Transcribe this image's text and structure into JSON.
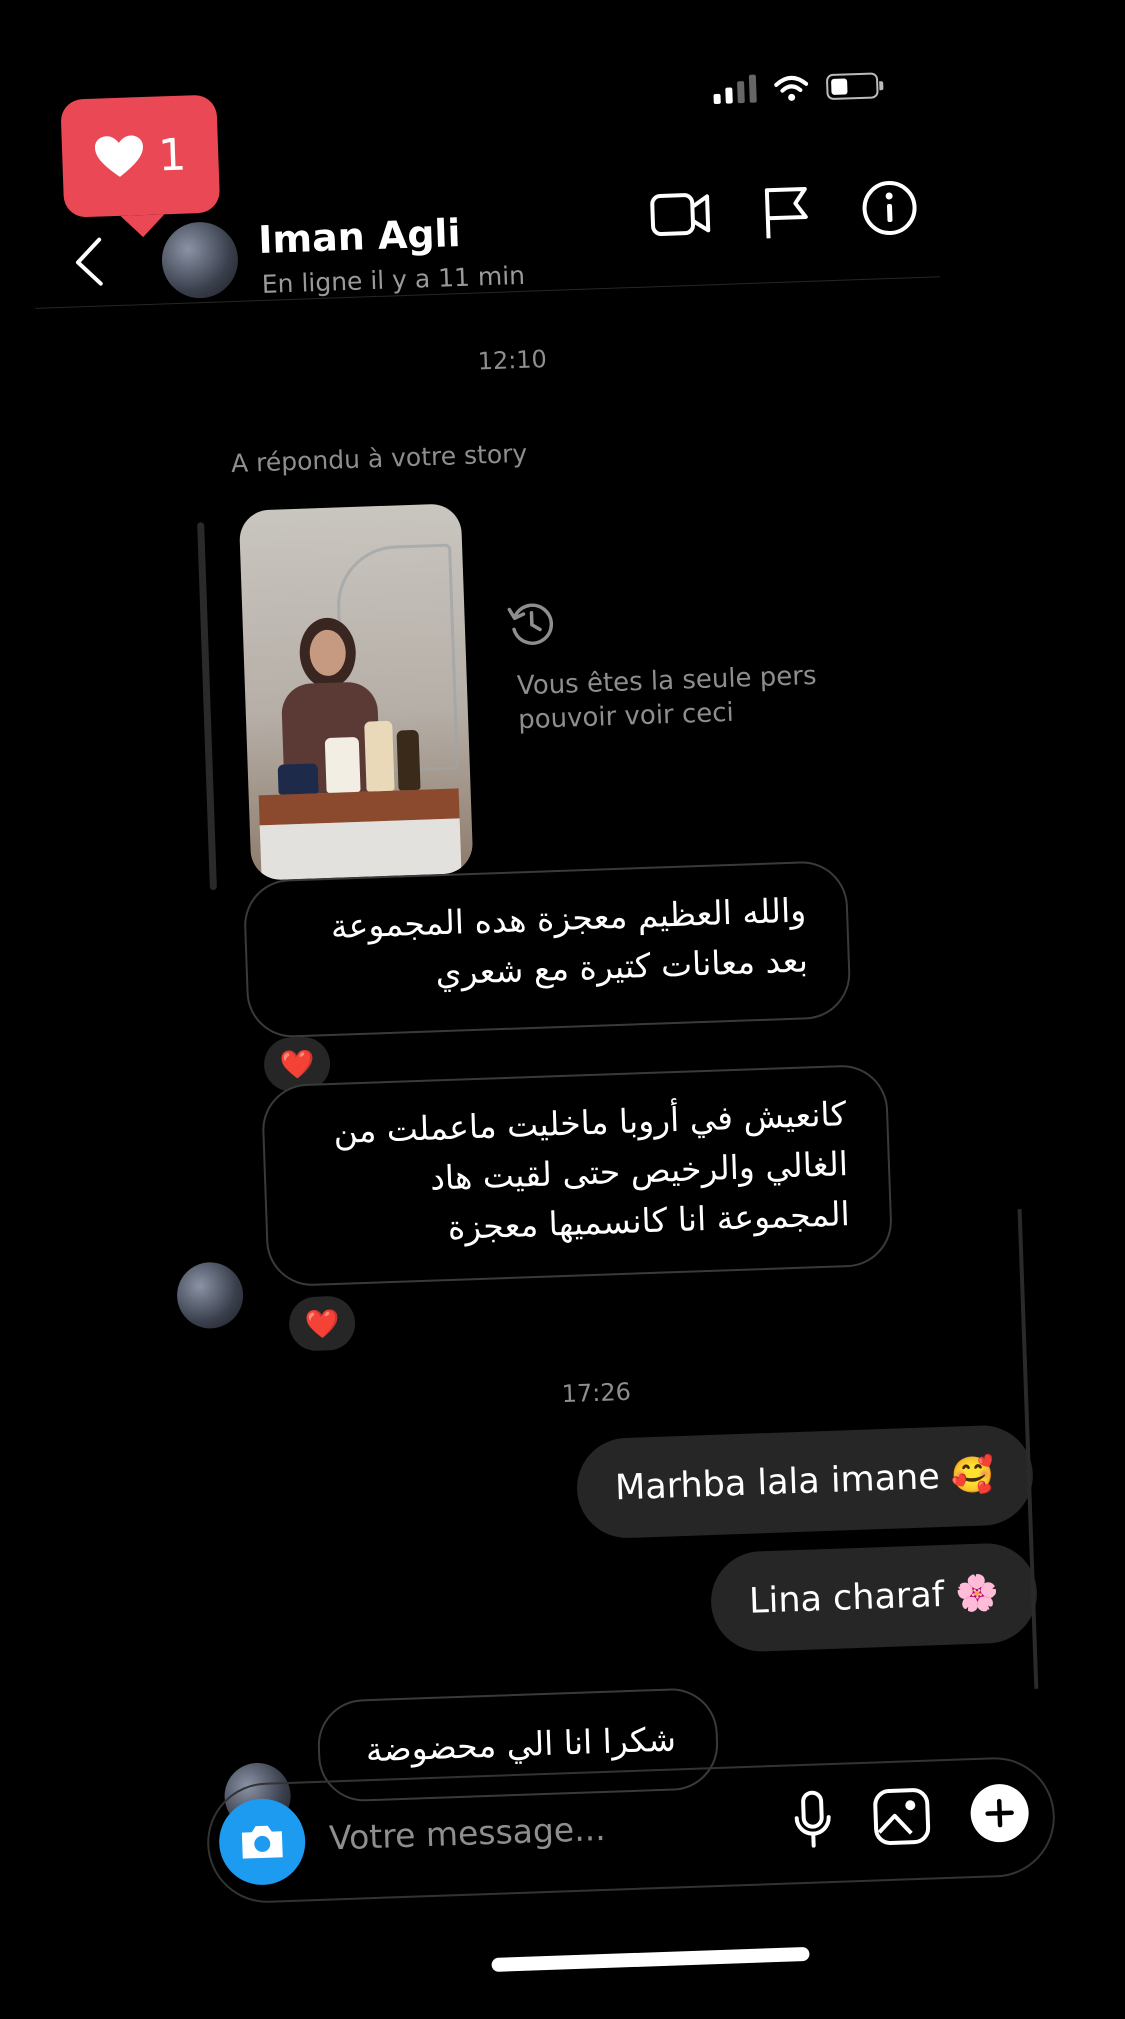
{
  "notification": {
    "like_count": "1",
    "icon": "heart-icon",
    "color": "#e94854"
  },
  "header": {
    "name": "Iman Agli",
    "status": "En ligne il y a 11 min",
    "icons": [
      "video-camera-icon",
      "flag-icon",
      "info-icon"
    ]
  },
  "thread": {
    "time_1": "12:10",
    "reply_note": "A répondu à votre story",
    "story_notice": "Vous êtes la seule pers pouvoir voir ceci",
    "msg_1": "والله العظيم معجزة  هده المجموعة بعد معانات كتيرة مع شعري",
    "msg_2": "كانعيش في أروبا ماخليت ماعملت من الغالي والرخيص حتى لقيت هاد المجموعة انا كانسميها معجزة",
    "reaction": "❤️",
    "time_2": "17:26",
    "out_1": "Marhba lala imane 🥰",
    "out_2": "Lina charaf 🌸",
    "msg_3": "شكرا انا الي محضوضة"
  },
  "composer": {
    "placeholder": "Votre message...",
    "icons": [
      "camera-icon",
      "microphone-icon",
      "image-icon",
      "plus-icon"
    ],
    "camera_color": "#1d9bf0"
  }
}
